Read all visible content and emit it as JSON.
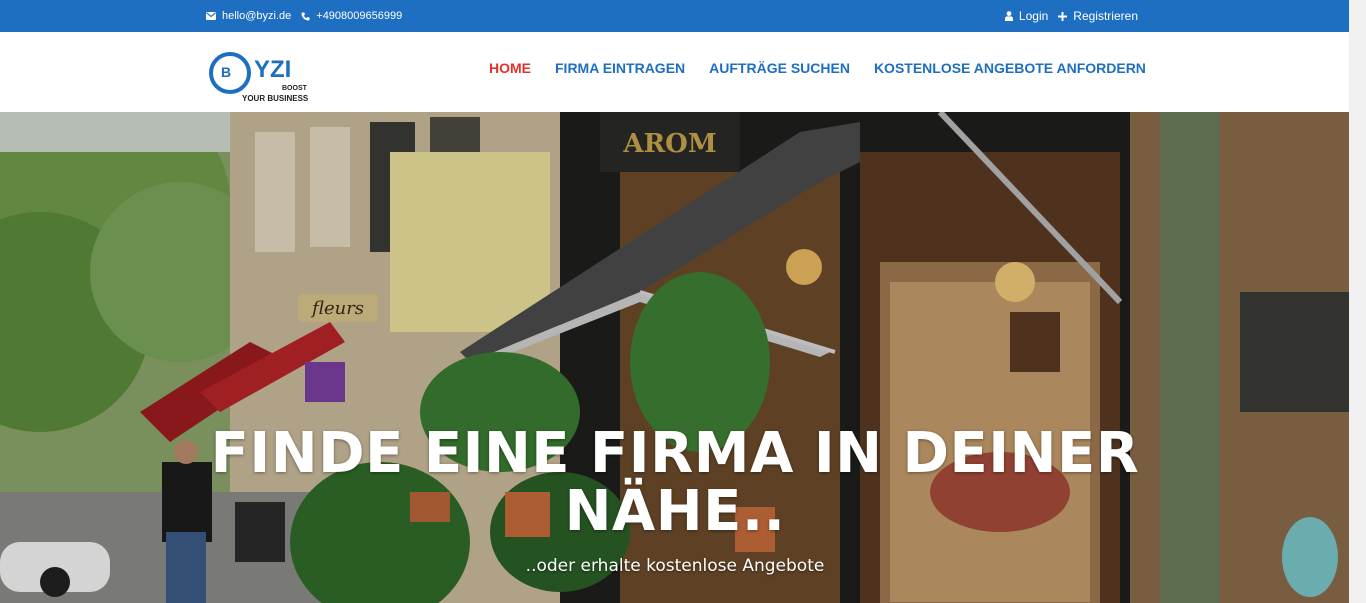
{
  "topbar": {
    "email": "hello@byzi.de",
    "phone": "+4908009656999",
    "login": "Login",
    "register": "Registrieren",
    "color": "#1e6fc2"
  },
  "logo": {
    "letter": "B",
    "word": "YZI",
    "tagline_top": "BOOST",
    "tagline_bottom": "YOUR BUSINESS"
  },
  "nav": {
    "items": [
      {
        "label": "HOME",
        "active": true
      },
      {
        "label": "FIRMA EINTRAGEN",
        "active": false
      },
      {
        "label": "AUFTRÄGE SUCHEN",
        "active": false
      },
      {
        "label": "KOSTENLOSE ANGEBOTE ANFORDERN",
        "active": false
      }
    ],
    "active_color": "#e0322c",
    "color": "#1e6fc2"
  },
  "hero": {
    "title": "FINDE EINE FIRMA IN DEINER NÄHE..",
    "subtitle": "..oder erhalte kostenlose Angebote",
    "sign_text": "fleurs",
    "awning_text": "AROM"
  },
  "icons": {
    "email": "envelope-icon",
    "phone": "phone-icon",
    "login": "user-icon",
    "register": "plus-icon"
  }
}
